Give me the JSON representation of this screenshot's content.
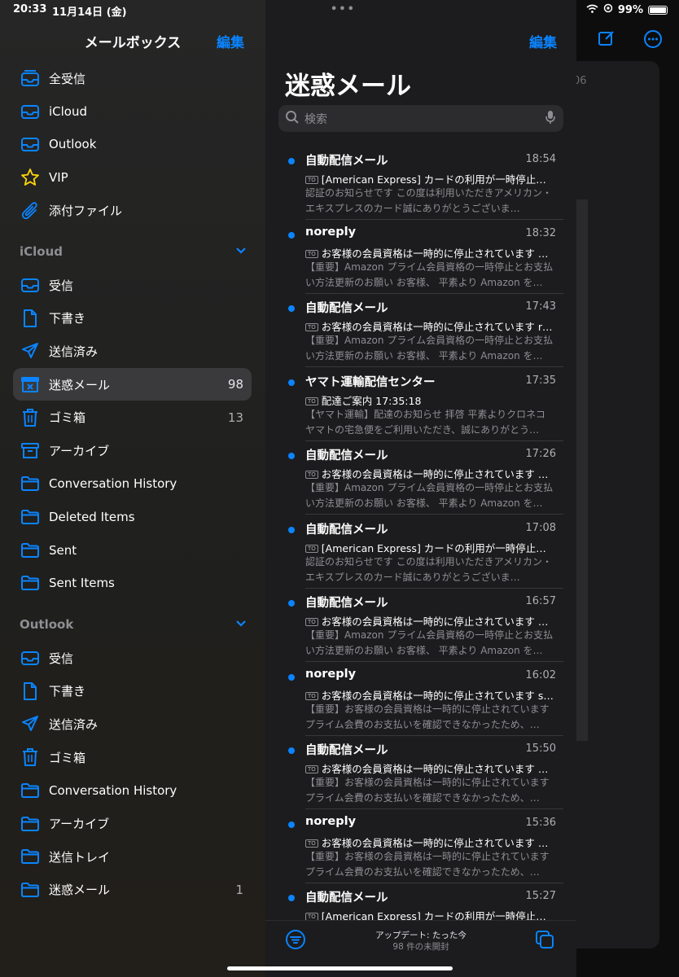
{
  "status": {
    "time": "20:33",
    "date": "11月14日 (金)",
    "battery": "99%"
  },
  "detail": {
    "date_peek": "06"
  },
  "sidebar": {
    "title": "メールボックス",
    "edit": "編集",
    "top_items": [
      {
        "label": "全受信",
        "icon": "all-inboxes-icon"
      },
      {
        "label": "iCloud",
        "icon": "inbox-icon"
      },
      {
        "label": "Outlook",
        "icon": "inbox-icon"
      },
      {
        "label": "VIP",
        "icon": "star-icon"
      },
      {
        "label": "添付ファイル",
        "icon": "paperclip-icon"
      }
    ],
    "icloud_section": "iCloud",
    "icloud_items": [
      {
        "label": "受信",
        "icon": "inbox-icon",
        "count": ""
      },
      {
        "label": "下書き",
        "icon": "document-icon",
        "count": ""
      },
      {
        "label": "送信済み",
        "icon": "paperplane-icon",
        "count": ""
      },
      {
        "label": "迷惑メール",
        "icon": "junk-icon",
        "count": "98"
      },
      {
        "label": "ゴミ箱",
        "icon": "trash-icon",
        "count": "13"
      },
      {
        "label": "アーカイブ",
        "icon": "archive-icon",
        "count": ""
      },
      {
        "label": "Conversation History",
        "icon": "folder-icon",
        "count": ""
      },
      {
        "label": "Deleted Items",
        "icon": "folder-icon",
        "count": ""
      },
      {
        "label": "Sent",
        "icon": "folder-icon",
        "count": ""
      },
      {
        "label": "Sent Items",
        "icon": "folder-icon",
        "count": ""
      }
    ],
    "outlook_section": "Outlook",
    "outlook_items": [
      {
        "label": "受信",
        "icon": "inbox-icon",
        "count": ""
      },
      {
        "label": "下書き",
        "icon": "document-icon",
        "count": ""
      },
      {
        "label": "送信済み",
        "icon": "paperplane-icon",
        "count": ""
      },
      {
        "label": "ゴミ箱",
        "icon": "trash-icon",
        "count": ""
      },
      {
        "label": "Conversation History",
        "icon": "folder-icon",
        "count": ""
      },
      {
        "label": "アーカイブ",
        "icon": "folder-icon",
        "count": ""
      },
      {
        "label": "送信トレイ",
        "icon": "folder-icon",
        "count": ""
      },
      {
        "label": "迷惑メール",
        "icon": "folder-icon",
        "count": "1"
      }
    ]
  },
  "list": {
    "edit": "編集",
    "title": "迷惑メール",
    "search_placeholder": "検索",
    "to_badge": "TO",
    "messages": [
      {
        "from": "自動配信メール",
        "time": "18:54",
        "subject": "[American Express] カードの利用が一時停止…",
        "preview": "認証のお知らせです この度は利用いただきアメリカン・エキスプレスのカード誠にありがとうございま…"
      },
      {
        "from": "noreply",
        "time": "18:32",
        "subject": "お客様の会員資格は一時的に停止されています Y…",
        "preview": "【重要】Amazon プライム会員資格の一時停止とお支払い方法更新のお願い お客様、 平素より Amazon を…"
      },
      {
        "from": "自動配信メール",
        "time": "17:43",
        "subject": "お客様の会員資格は一時的に停止されています rl…",
        "preview": "【重要】Amazon プライム会員資格の一時停止とお支払い方法更新のお願い お客様、 平素より Amazon を…"
      },
      {
        "from": "ヤマト運輸配信センター",
        "time": "17:35",
        "subject": "配達ご案内 17:35:18",
        "preview": "【ヤマト運輸】配達のお知らせ 拝啓 平素よりクロネコヤマトの宅急便をご利用いただき、誠にありがとう…"
      },
      {
        "from": "自動配信メール",
        "time": "17:26",
        "subject": "お客様の会員資格は一時的に停止されています 4…",
        "preview": "【重要】Amazon プライム会員資格の一時停止とお支払い方法更新のお願い お客様、 平素より Amazon を…"
      },
      {
        "from": "自動配信メール",
        "time": "17:08",
        "subject": "[American Express] カードの利用が一時停止…",
        "preview": "認証のお知らせです この度は利用いただきアメリカン・エキスプレスのカード誠にありがとうございま…"
      },
      {
        "from": "自動配信メール",
        "time": "16:57",
        "subject": "お客様の会員資格は一時的に停止されています 5…",
        "preview": "【重要】Amazon プライム会員資格の一時停止とお支払い方法更新のお願い お客様、 平素より Amazon を…"
      },
      {
        "from": "noreply",
        "time": "16:02",
        "subject": "お客様の会員資格は一時的に停止されています s…",
        "preview": "【重要】お客様の会員資格は一時的に停止されています プライム会費のお支払いを確認できなかったため、…"
      },
      {
        "from": "自動配信メール",
        "time": "15:50",
        "subject": "お客様の会員資格は一時的に停止されています Q…",
        "preview": "【重要】お客様の会員資格は一時的に停止されています プライム会費のお支払いを確認できなかったため、…"
      },
      {
        "from": "noreply",
        "time": "15:36",
        "subject": "お客様の会員資格は一時的に停止されています pi…",
        "preview": "【重要】お客様の会員資格は一時的に停止されています プライム会費のお支払いを確認できなかったため、…"
      },
      {
        "from": "自動配信メール",
        "time": "15:27",
        "subject": "[American Express] カードの利用が一時停止…",
        "preview": ""
      }
    ]
  },
  "toolbar": {
    "updated": "アップデート: たった今",
    "unread": "98 件の未開封"
  },
  "colors": {
    "accent": "#0a84ff",
    "sidebar_bg": "#262626",
    "list_bg": "#1c1c1e",
    "selected": "#3a3a3c"
  }
}
